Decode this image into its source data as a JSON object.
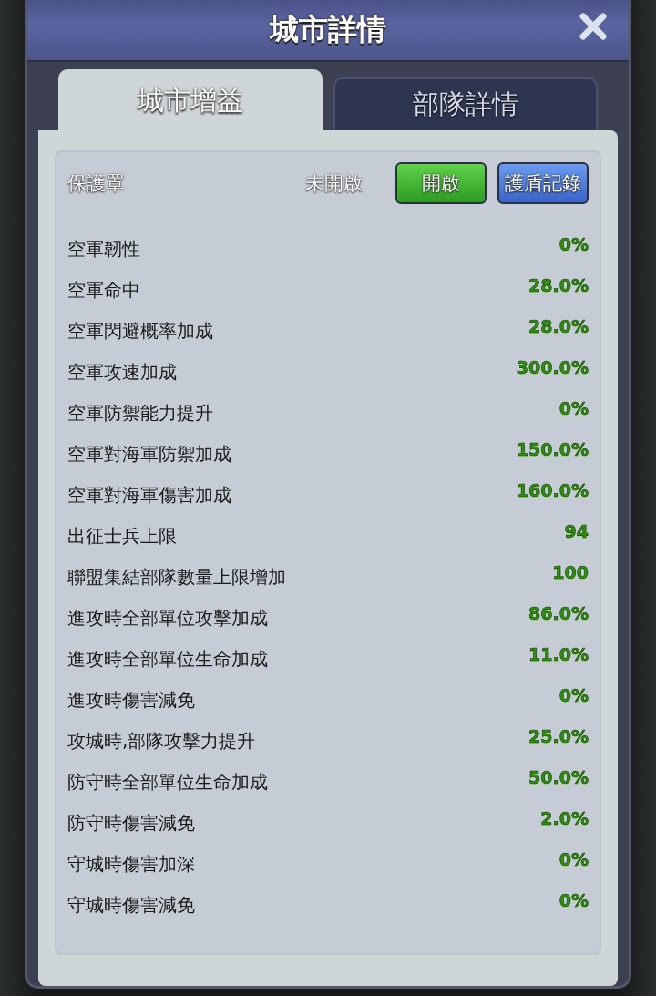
{
  "window": {
    "title": "城市詳情"
  },
  "tabs": [
    {
      "label": "城市增益",
      "selected": true
    },
    {
      "label": "部隊詳情",
      "selected": false
    }
  ],
  "shield": {
    "label": "保護罩",
    "status": "未開啟",
    "buttons": [
      {
        "label": "開啟",
        "kind": "primary"
      },
      {
        "label": "護盾記錄",
        "kind": "secondary"
      }
    ]
  },
  "stats": [
    {
      "name": "空軍韌性",
      "value": "0%"
    },
    {
      "name": "空軍命中",
      "value": "28.0%"
    },
    {
      "name": "空軍閃避概率加成",
      "value": "28.0%"
    },
    {
      "name": "空軍攻速加成",
      "value": "300.0%"
    },
    {
      "name": "空軍防禦能力提升",
      "value": "0%"
    },
    {
      "name": "空軍對海軍防禦加成",
      "value": "150.0%"
    },
    {
      "name": "空軍對海軍傷害加成",
      "value": "160.0%"
    },
    {
      "name": "出征士兵上限",
      "value": "94"
    },
    {
      "name": "聯盟集結部隊數量上限增加",
      "value": "100"
    },
    {
      "name": "進攻時全部單位攻擊加成",
      "value": "86.0%"
    },
    {
      "name": "進攻時全部單位生命加成",
      "value": "11.0%"
    },
    {
      "name": "進攻時傷害減免",
      "value": "0%"
    },
    {
      "name": "攻城時,部隊攻擊力提升",
      "value": "25.0%"
    },
    {
      "name": "防守時全部單位生命加成",
      "value": "50.0%"
    },
    {
      "name": "防守時傷害減免",
      "value": "2.0%"
    },
    {
      "name": "守城時傷害加深",
      "value": "0%"
    },
    {
      "name": "守城時傷害減免",
      "value": "0%"
    }
  ]
}
